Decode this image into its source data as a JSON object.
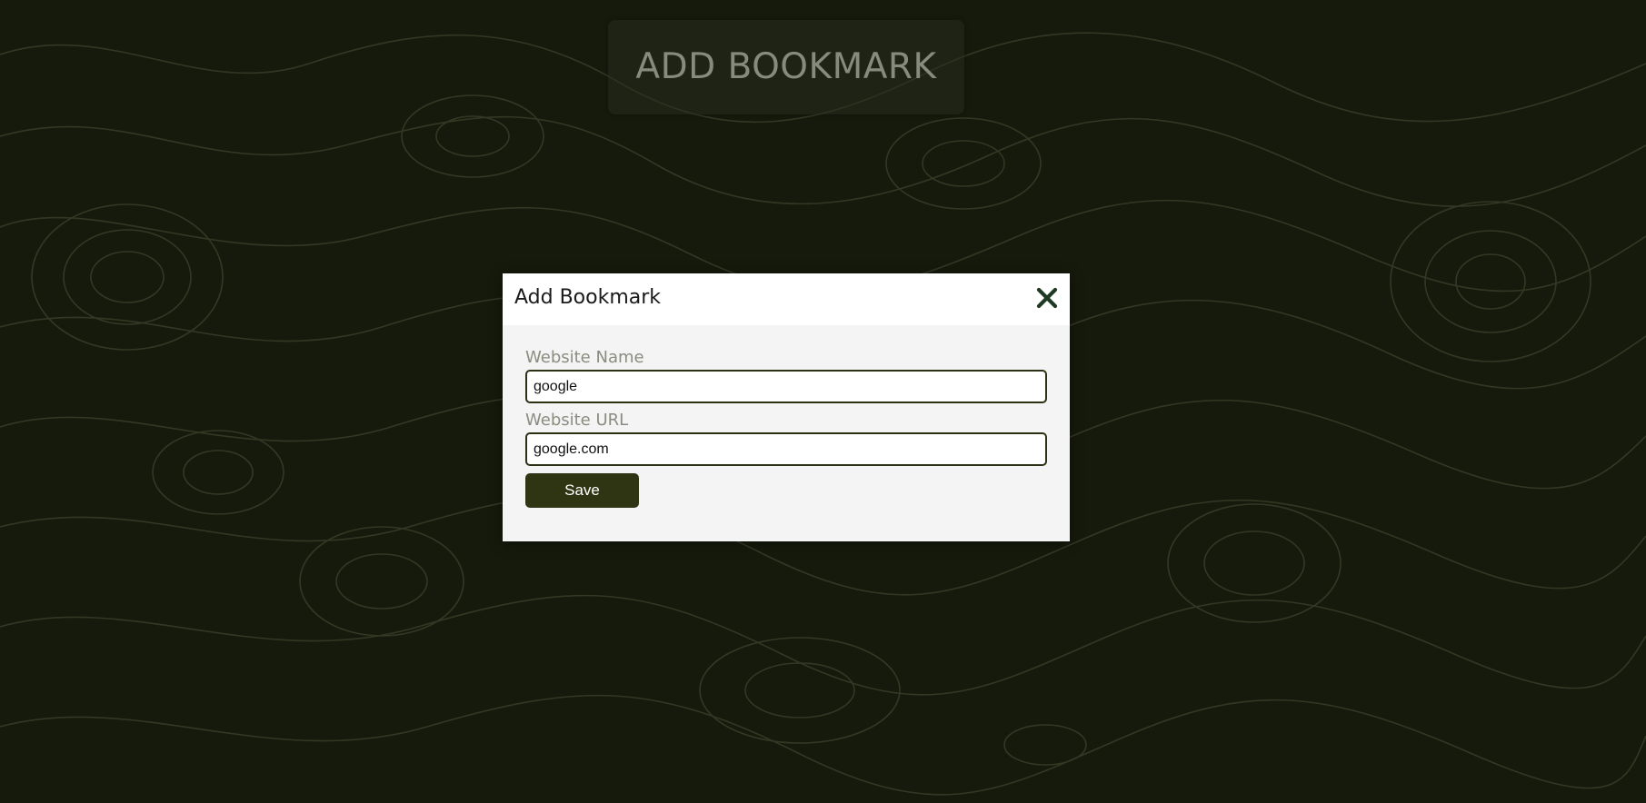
{
  "page": {
    "header_button_label": "ADD BOOKMARK"
  },
  "modal": {
    "title": "Add Bookmark",
    "close_icon": "close-icon",
    "fields": {
      "name_label": "Website Name",
      "name_value": "google",
      "url_label": "Website URL",
      "url_value": "google.com"
    },
    "save_label": "Save"
  },
  "colors": {
    "background": "#161a0c",
    "accent": "#2f3512",
    "close_icon": "#1f3a22",
    "label": "#8a8d80"
  }
}
